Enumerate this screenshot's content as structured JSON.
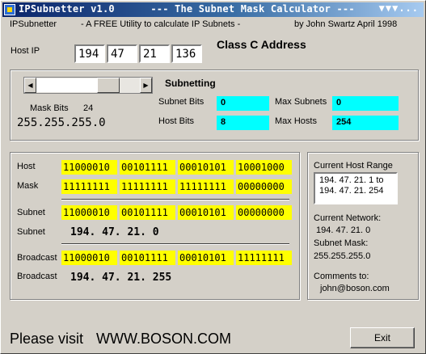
{
  "window": {
    "title": "IPSubnetter v1.0      --- The Subnet Mask Calculator ---",
    "controls": "▼▼▼..."
  },
  "header": {
    "app_name": "IPSubnetter",
    "tagline": "- A FREE Utility to calculate IP Subnets -",
    "author": "by John Swartz  April 1998"
  },
  "host_ip": {
    "label": "Host IP",
    "octets": [
      "194",
      "47",
      "21",
      "136"
    ],
    "class_text": "Class C Address"
  },
  "mask_slider": {
    "label": "Mask Bits",
    "value": "24",
    "dotted": "255.255.255.0",
    "left_arrow": "◀",
    "right_arrow": "▶",
    "position_fraction": 0.75
  },
  "subnetting": {
    "title": "Subnetting",
    "subnet_bits_label": "Subnet Bits",
    "subnet_bits": "0",
    "max_subnets_label": "Max Subnets",
    "max_subnets": "0",
    "host_bits_label": "Host Bits",
    "host_bits": "8",
    "max_hosts_label": "Max Hosts",
    "max_hosts": "254"
  },
  "binary": {
    "host_label": "Host",
    "host": [
      "11000010",
      "00101111",
      "00010101",
      "10001000"
    ],
    "mask_label": "Mask",
    "mask": [
      "11111111",
      "11111111",
      "11111111",
      "00000000"
    ],
    "subnet_label": "Subnet",
    "subnet": [
      "11000010",
      "00101111",
      "00010101",
      "00000000"
    ],
    "subnet_dec_label": "Subnet",
    "subnet_dec": "194. 47. 21. 0",
    "broadcast_label": "Broadcast",
    "broadcast": [
      "11000010",
      "00101111",
      "00010101",
      "11111111"
    ],
    "broadcast_dec_label": "Broadcast",
    "broadcast_dec": "194. 47. 21. 255"
  },
  "info": {
    "range_label": "Current Host Range",
    "range_line1": "194. 47. 21. 1 to",
    "range_line2": "194. 47. 21. 254",
    "network_label": "Current Network:",
    "network": "194. 47. 21. 0",
    "mask_label": "Subnet Mask:",
    "mask": "255.255.255.0",
    "comments_label": "Comments to:",
    "email": "john@boson.com"
  },
  "footer": {
    "visit_text": "Please visit",
    "url": "WWW.BOSON.COM",
    "exit_label": "Exit"
  },
  "colors": {
    "binary_highlight": "#ffff00",
    "stat_highlight": "#00ffff",
    "window_bg": "#d4d0c8"
  }
}
